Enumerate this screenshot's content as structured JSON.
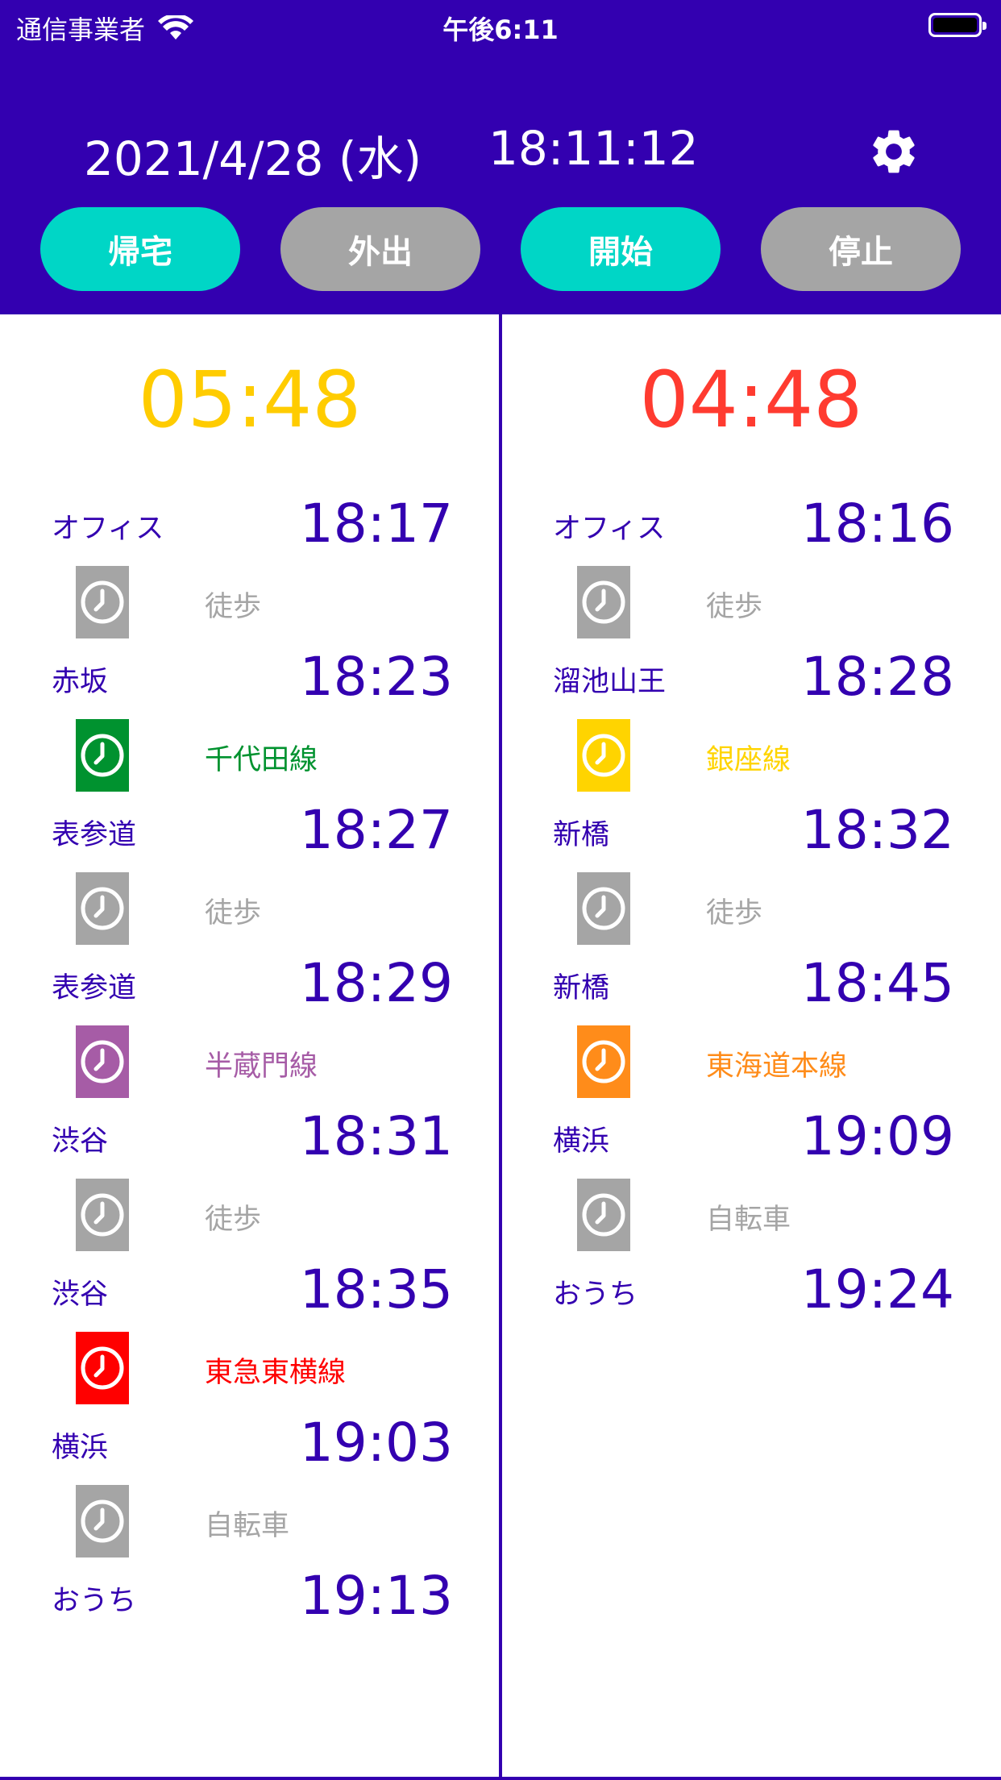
{
  "status_bar": {
    "carrier": "通信事業者",
    "time": "午後6:11"
  },
  "header": {
    "date": "2021/4/28 (水)",
    "clock": "18:11:12",
    "buttons": [
      {
        "label": "帰宅",
        "active": true
      },
      {
        "label": "外出",
        "active": false
      },
      {
        "label": "開始",
        "active": true
      },
      {
        "label": "停止",
        "active": false
      }
    ]
  },
  "colors": {
    "header_bg": "#3300b0",
    "accent_on": "#00d6c6",
    "accent_off": "#a5a5a5",
    "walk": "#a5a5a5",
    "chiyoda": "#00922f",
    "hanzomon": "#a65ca6",
    "toyoko": "#ff0000",
    "ginza": "#ffd400",
    "tokaido": "#ff8c1a"
  },
  "routes": [
    {
      "countdown": "05:48",
      "countdown_color": "#ffcc00",
      "stops": [
        {
          "name": "オフィス",
          "time": "18:17"
        },
        {
          "name": "赤坂",
          "time": "18:23"
        },
        {
          "name": "表参道",
          "time": "18:27"
        },
        {
          "name": "表参道",
          "time": "18:29"
        },
        {
          "name": "渋谷",
          "time": "18:31"
        },
        {
          "name": "渋谷",
          "time": "18:35"
        },
        {
          "name": "横浜",
          "time": "19:03"
        },
        {
          "name": "おうち",
          "time": "19:13"
        }
      ],
      "segments": [
        {
          "label": "徒歩",
          "color": "#a5a5a5",
          "icon": "clock-icon"
        },
        {
          "label": "千代田線",
          "color": "#00922f",
          "icon": "clock-icon"
        },
        {
          "label": "徒歩",
          "color": "#a5a5a5",
          "icon": "clock-icon"
        },
        {
          "label": "半蔵門線",
          "color": "#a65ca6",
          "icon": "clock-icon"
        },
        {
          "label": "徒歩",
          "color": "#a5a5a5",
          "icon": "clock-icon"
        },
        {
          "label": "東急東横線",
          "color": "#ff0000",
          "icon": "clock-icon"
        },
        {
          "label": "自転車",
          "color": "#a5a5a5",
          "icon": "clock-icon"
        }
      ]
    },
    {
      "countdown": "04:48",
      "countdown_color": "#ff3b30",
      "stops": [
        {
          "name": "オフィス",
          "time": "18:16"
        },
        {
          "name": "溜池山王",
          "time": "18:28"
        },
        {
          "name": "新橋",
          "time": "18:32"
        },
        {
          "name": "新橋",
          "time": "18:45"
        },
        {
          "name": "横浜",
          "time": "19:09"
        },
        {
          "name": "おうち",
          "time": "19:24"
        }
      ],
      "segments": [
        {
          "label": "徒歩",
          "color": "#a5a5a5",
          "icon": "clock-icon"
        },
        {
          "label": "銀座線",
          "color": "#ffd400",
          "icon": "clock-icon"
        },
        {
          "label": "徒歩",
          "color": "#a5a5a5",
          "icon": "clock-icon"
        },
        {
          "label": "東海道本線",
          "color": "#ff8c1a",
          "icon": "clock-icon"
        },
        {
          "label": "自転車",
          "color": "#a5a5a5",
          "icon": "clock-icon"
        }
      ]
    }
  ]
}
